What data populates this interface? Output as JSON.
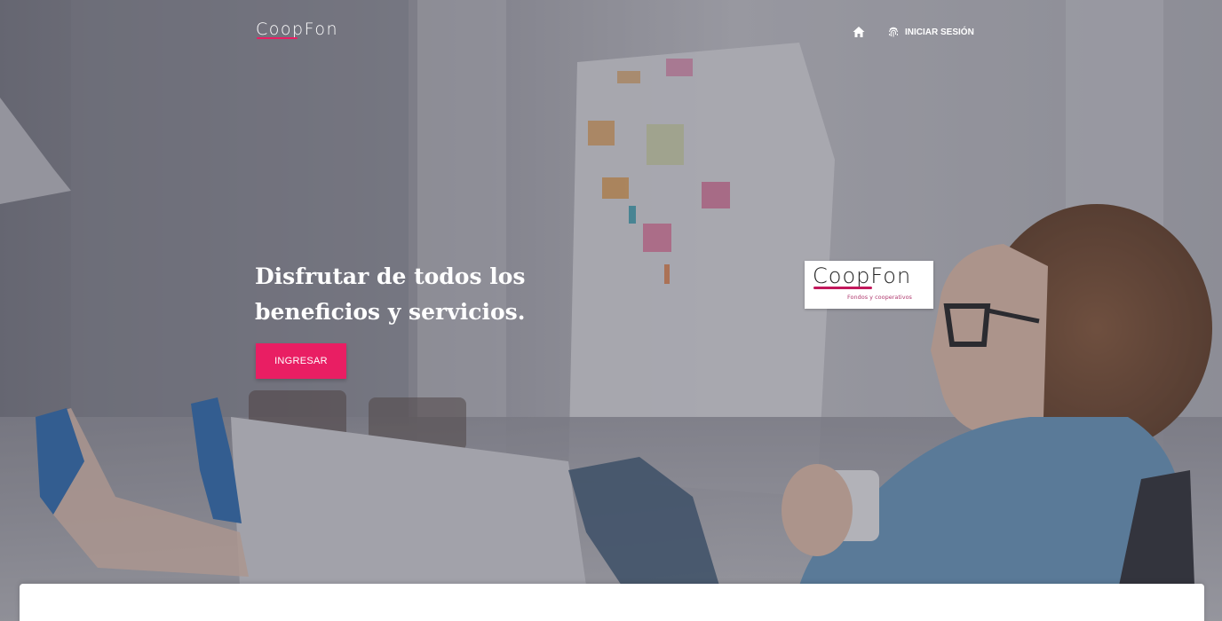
{
  "header": {
    "brand": "CoopFon",
    "nav": {
      "home_icon": "home-icon",
      "login_icon": "fingerprint-icon",
      "login_label": "INICIAR SESIÓN"
    }
  },
  "hero": {
    "headline_line1": "Disfrutar de todos los",
    "headline_line2": "beneficios y servicios.",
    "cta_label": "INGRESAR",
    "logo_card": {
      "wordmark": "CoopFon",
      "tagline": "Fondos y cooperativos"
    }
  },
  "colors": {
    "accent": "#e91e63",
    "text_on_dark": "#ffffff",
    "panel": "#ffffff"
  }
}
